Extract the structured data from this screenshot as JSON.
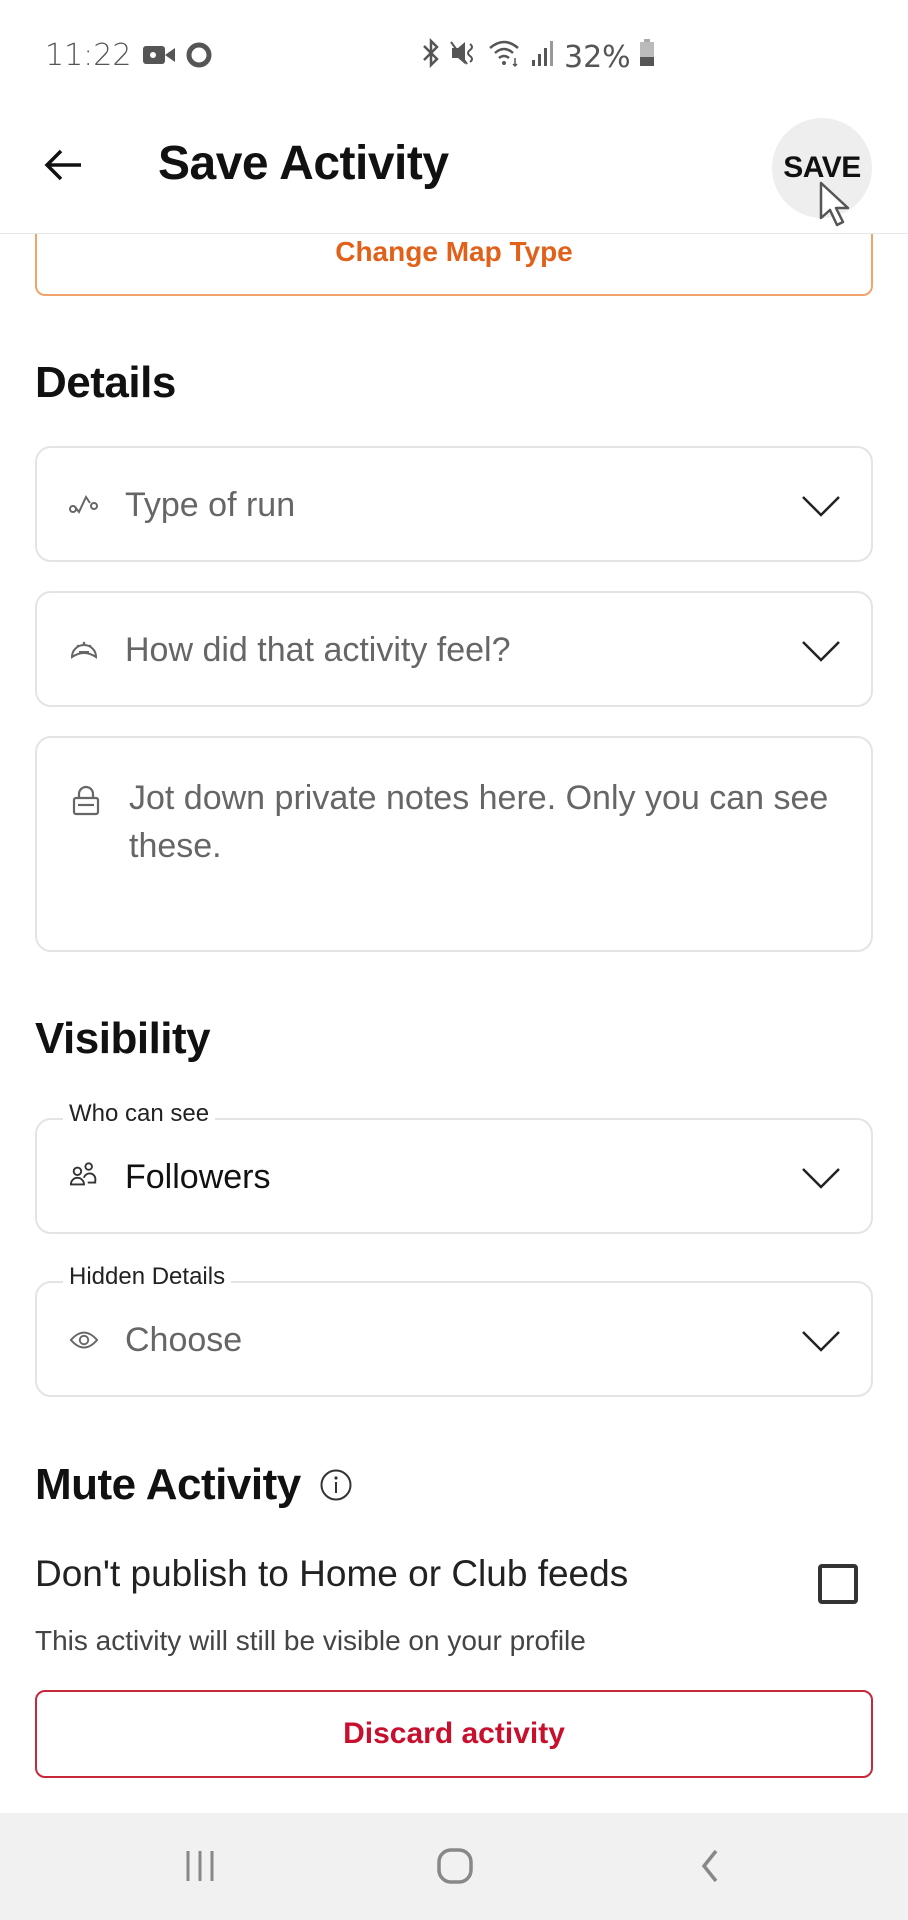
{
  "status_bar": {
    "time": "11:22",
    "battery": "32%",
    "left_icons": [
      "video-recording-icon",
      "record-dot-icon"
    ],
    "right_icons": [
      "bluetooth-icon",
      "mute-vibrate-icon",
      "wifi-icon",
      "signal-icon",
      "battery-icon"
    ]
  },
  "app_bar": {
    "title": "Save Activity",
    "back_icon": "arrow-left-icon",
    "save_label": "SAVE"
  },
  "map": {
    "change_map_type_label": "Change Map Type"
  },
  "details": {
    "title": "Details",
    "type_of_run": {
      "placeholder": "Type of run",
      "icon": "workout-type-icon"
    },
    "feel": {
      "placeholder": "How did that activity feel?",
      "icon": "perceived-exertion-icon"
    },
    "private_notes": {
      "placeholder": "Jot down private notes here. Only you can see these.",
      "icon": "lock-icon"
    }
  },
  "visibility": {
    "title": "Visibility",
    "who_can_see": {
      "label": "Who can see",
      "value": "Followers",
      "icon": "followers-icon"
    },
    "hidden_details": {
      "label": "Hidden Details",
      "placeholder": "Choose",
      "icon": "eye-icon"
    }
  },
  "mute": {
    "title": "Mute Activity",
    "info_icon": "info-icon",
    "publish_label": "Don't publish to Home or Club feeds",
    "checked": false,
    "note": "This activity will still be visible on your profile"
  },
  "discard_label": "Discard activity",
  "nav_bar": {
    "buttons": [
      "recent-apps-icon",
      "home-icon",
      "back-icon"
    ]
  },
  "colors": {
    "accent_orange": "#e2611a",
    "discard_red": "#c8102e"
  }
}
